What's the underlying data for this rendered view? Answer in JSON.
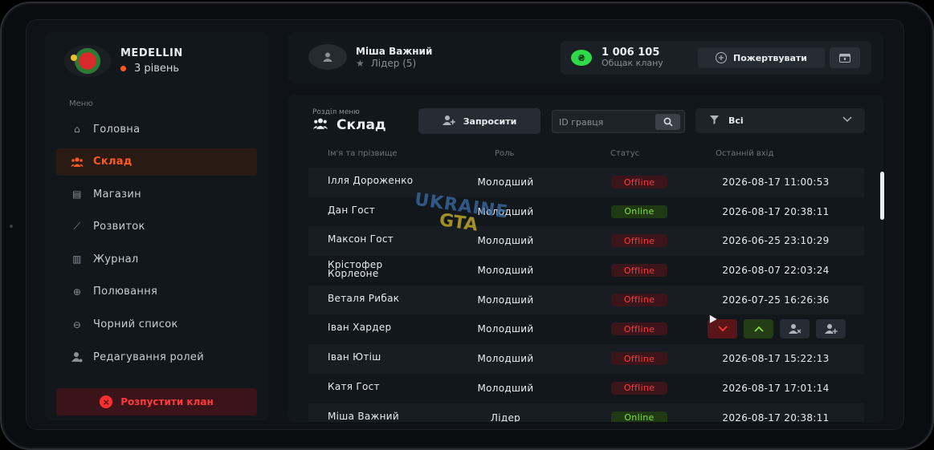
{
  "clan": {
    "name": "MEDELLIN",
    "level": "3 рівень"
  },
  "sidebar": {
    "menu_label": "Меню",
    "items": [
      {
        "label": "Головна",
        "icon": "home-icon",
        "active": false
      },
      {
        "label": "Склад",
        "icon": "users-icon",
        "active": true
      },
      {
        "label": "Магазин",
        "icon": "shop-icon",
        "active": false
      },
      {
        "label": "Розвиток",
        "icon": "chart-icon",
        "active": false
      },
      {
        "label": "Журнал",
        "icon": "book-icon",
        "active": false
      },
      {
        "label": "Полювання",
        "icon": "target-icon",
        "active": false
      },
      {
        "label": "Чорний список",
        "icon": "block-icon",
        "active": false
      },
      {
        "label": "Редагування ролей",
        "icon": "user-cog-icon",
        "active": false
      }
    ],
    "disband_label": "Розпустити клан"
  },
  "user": {
    "name": "Міша Важний",
    "role": "Лідер (5)"
  },
  "wallet": {
    "balance": "1 006 105",
    "label": "Общак клану",
    "currency_symbol": "₴",
    "donate_label": "Пожертвувати"
  },
  "section": {
    "label": "Розділ меню",
    "title": "Склад",
    "invite_label": "Запросити",
    "search_placeholder": "ID гравця",
    "filter_value": "Всі"
  },
  "table": {
    "headers": {
      "name": "Ім'я та прізвище",
      "role": "Роль",
      "status": "Статус",
      "last": "Останній вхід"
    },
    "rows": [
      {
        "name": "Ілля Дороженко",
        "role": "Молодший",
        "status": "Offline",
        "last": "2026-08-17 11:00:53"
      },
      {
        "name": "Дан Гост",
        "role": "Молодший",
        "status": "Online",
        "last": "2026-08-17 20:38:11"
      },
      {
        "name": "Максон Гост",
        "role": "Молодший",
        "status": "Offline",
        "last": "2026-06-25 23:10:29"
      },
      {
        "name": "Крістофер Корлеоне",
        "role": "Молодший",
        "status": "Offline",
        "last": "2026-08-07 22:03:24"
      },
      {
        "name": "Веталя Рибак",
        "role": "Молодший",
        "status": "Offline",
        "last": "2026-07-25 16:26:36"
      },
      {
        "name": "Іван Хардер",
        "role": "Молодший",
        "status": "Offline",
        "last": ""
      },
      {
        "name": "Іван Ютіш",
        "role": "Молодший",
        "status": "Offline",
        "last": "2026-08-17 15:22:13"
      },
      {
        "name": "Катя Гост",
        "role": "Молодший",
        "status": "Offline",
        "last": "2026-08-17 17:01:14"
      },
      {
        "name": "Міша Важний",
        "role": "Лідер",
        "status": "Online",
        "last": "2026-08-17 20:38:11"
      }
    ]
  },
  "watermark": {
    "line1": "UKRAINE",
    "line2": "GTA"
  },
  "colors": {
    "accent": "#ff5a1f",
    "offline": "#ff3838",
    "online": "#7ee23a",
    "coin": "#2fd94a"
  }
}
